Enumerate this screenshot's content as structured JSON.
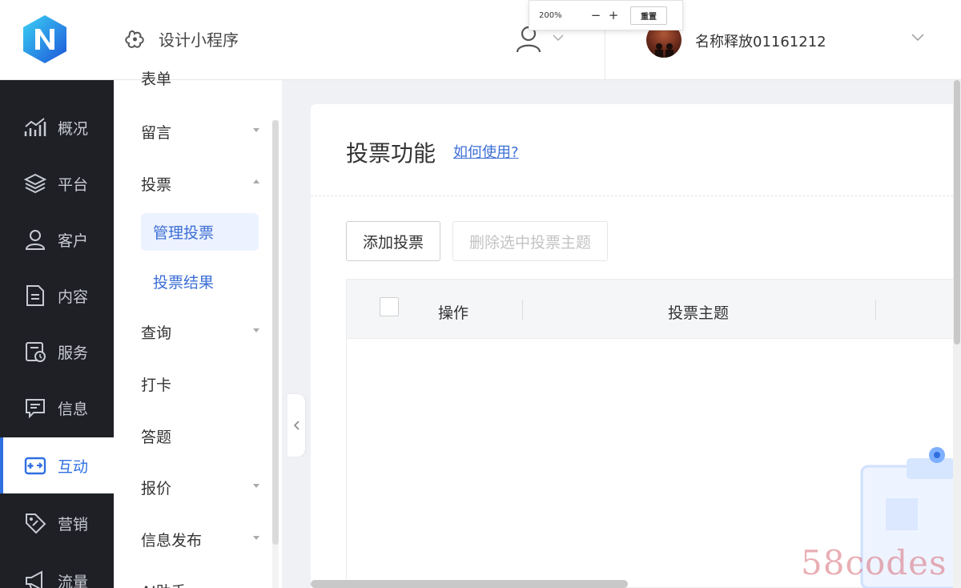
{
  "header": {
    "app_name": "设计小程序",
    "username": "名称释放01161212"
  },
  "zoom": {
    "level": "200%",
    "minus": "−",
    "plus": "+",
    "reset_label": "重置"
  },
  "nav": {
    "items": [
      {
        "label": "概况",
        "icon": "chart-trend-icon"
      },
      {
        "label": "平台",
        "icon": "layers-icon"
      },
      {
        "label": "客户",
        "icon": "user-icon"
      },
      {
        "label": "内容",
        "icon": "document-icon"
      },
      {
        "label": "服务",
        "icon": "service-icon"
      },
      {
        "label": "信息",
        "icon": "message-icon"
      },
      {
        "label": "互动",
        "icon": "gamepad-icon",
        "active": true
      },
      {
        "label": "营销",
        "icon": "tag-icon"
      },
      {
        "label": "流量",
        "icon": "megaphone-icon"
      }
    ]
  },
  "submenu": {
    "items": [
      {
        "label": "表单"
      },
      {
        "label": "留言"
      },
      {
        "label": "投票"
      },
      {
        "label": "查询"
      },
      {
        "label": "打卡"
      },
      {
        "label": "答题"
      },
      {
        "label": "报价"
      },
      {
        "label": "信息发布"
      },
      {
        "label": "AI助手"
      }
    ],
    "vote_children": [
      {
        "label": "管理投票",
        "active": true
      },
      {
        "label": "投票结果"
      }
    ]
  },
  "main": {
    "title": "投票功能",
    "help_link": "如何使用?",
    "add_button": "添加投票",
    "delete_button": "删除选中投票主题",
    "table": {
      "columns": [
        "操作",
        "投票主题"
      ]
    }
  },
  "watermark": "58codes",
  "colors": {
    "accent": "#2f6fe0",
    "nav_bg": "#1e2026",
    "link": "#3d6fd6"
  }
}
